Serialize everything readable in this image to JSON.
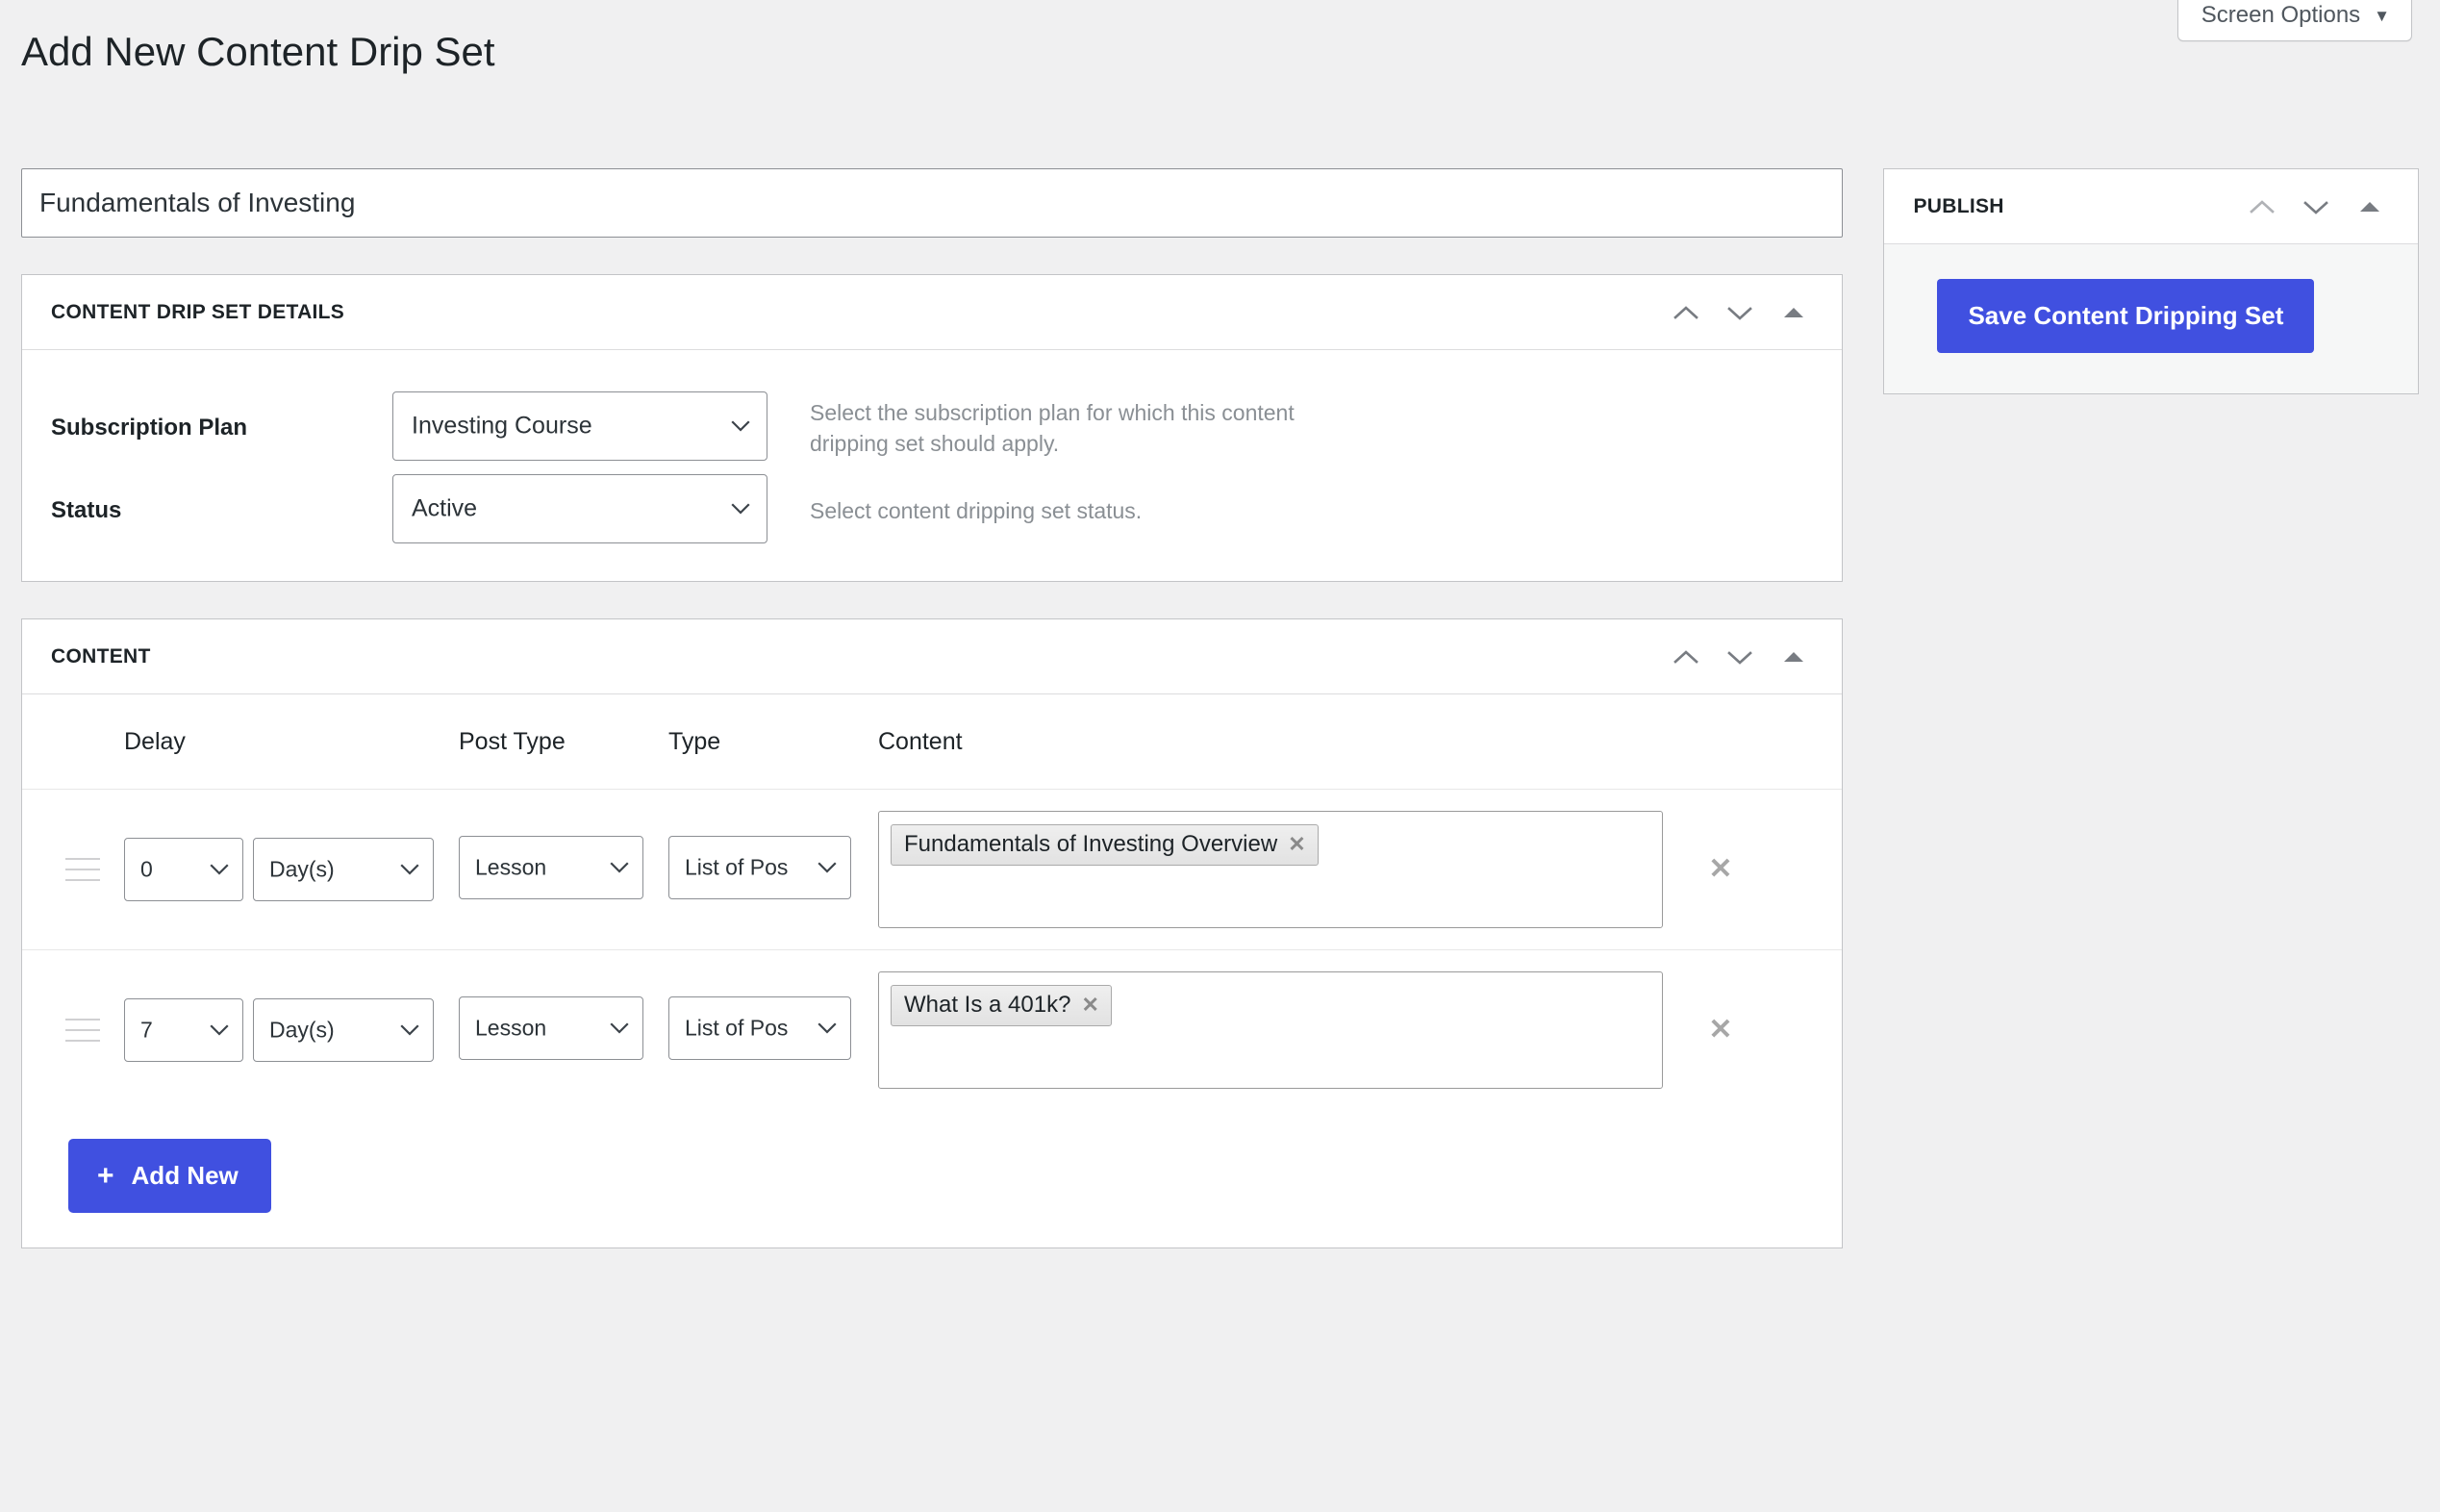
{
  "screen_options": {
    "label": "Screen Options",
    "caret": "chevron-down-icon"
  },
  "page_title": "Add New Content Drip Set",
  "title_field": {
    "value": "Fundamentals of Investing",
    "placeholder": "Add title"
  },
  "details_panel": {
    "title": "CONTENT DRIP SET DETAILS",
    "actions": [
      "move-up",
      "move-down",
      "toggle"
    ],
    "fields": [
      {
        "label": "Subscription Plan",
        "value": "Investing Course",
        "help": "Select the subscription plan for which this content dripping set should apply."
      },
      {
        "label": "Status",
        "value": "Active",
        "help": "Select content dripping set status."
      }
    ]
  },
  "content_panel": {
    "title": "CONTENT",
    "actions": [
      "move-up",
      "move-down",
      "toggle"
    ],
    "columns": [
      "Delay",
      "Post Type",
      "Type",
      "Content"
    ],
    "rows": [
      {
        "delay": "0",
        "unit": "Day(s)",
        "post_type": "Lesson",
        "type": "List of Pos",
        "tags": [
          "Fundamentals of Investing Overview"
        ],
        "remove_label": "✕"
      },
      {
        "delay": "7",
        "unit": "Day(s)",
        "post_type": "Lesson",
        "type": "List of Pos",
        "tags": [
          "What Is a 401k?"
        ],
        "remove_label": "✕"
      }
    ],
    "add_new_label": "Add New",
    "add_new_icon": "plus-icon"
  },
  "publish_panel": {
    "title": "PUBLISH",
    "actions": [
      "move-up",
      "move-down",
      "toggle"
    ],
    "save_label": "Save Content Dripping Set"
  },
  "colors": {
    "accent": "#4050e0",
    "page_bg": "#f0f0f1",
    "panel_border": "#c3c4c7",
    "muted_text": "#8a8f94"
  }
}
